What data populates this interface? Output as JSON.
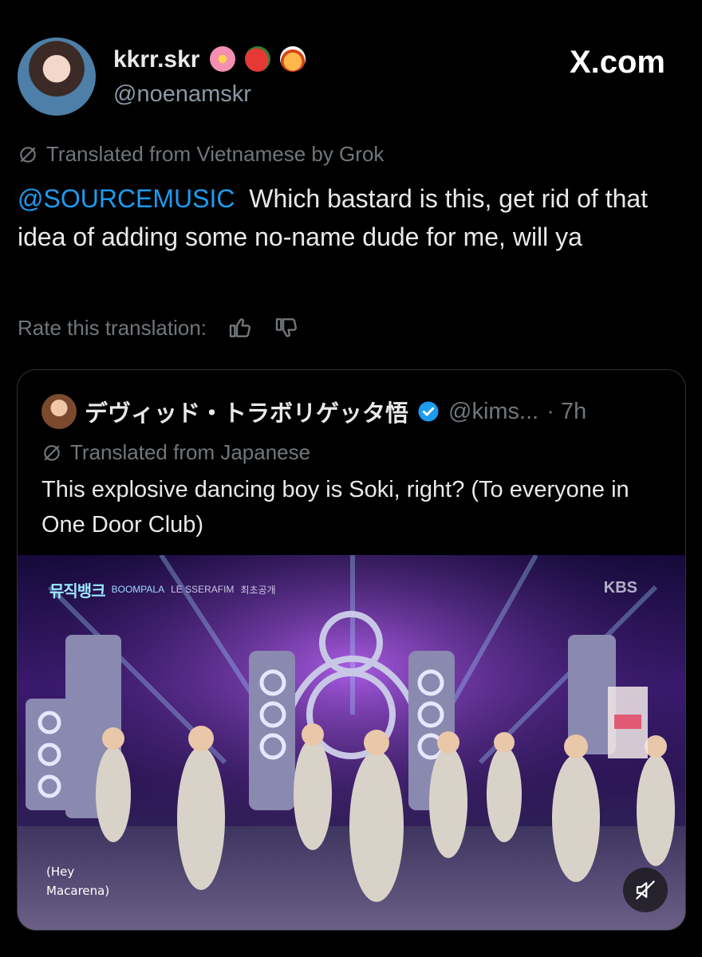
{
  "post": {
    "display_name": "kkrr.skr",
    "handle": "@noenamskr",
    "brand": "X.com",
    "translated_note": "Translated from Vietnamese by Grok",
    "mention": "@SOURCEMUSIC",
    "text": "Which bastard is this, get rid of that idea of adding some no-name dude for me, will ya",
    "rate_label": "Rate this translation:",
    "emoji_icons": [
      "cherry-blossom-icon",
      "tomato-icon",
      "spaghetti-icon"
    ]
  },
  "quote": {
    "display_name": "デヴィッド・トラボリゲッタ悟",
    "handle": "@kims...",
    "time": "· 7h",
    "translated_note": "Translated from Japanese",
    "text": "This explosive dancing boy is Soki, right? (To everyone in One Door Club)",
    "media": {
      "banner_logo": "뮤직뱅크",
      "banner_song": "BOOMPALA",
      "banner_artist": "LE SSERAFIM",
      "banner_tag": "최초공개",
      "broadcaster": "KBS",
      "subtitle_line1": "(Hey",
      "subtitle_line2": "Macarena)"
    }
  },
  "colors": {
    "background": "#000000",
    "text": "#e7e9ea",
    "muted": "#71767b",
    "link": "#1d9bf0",
    "border": "#2f3336"
  }
}
